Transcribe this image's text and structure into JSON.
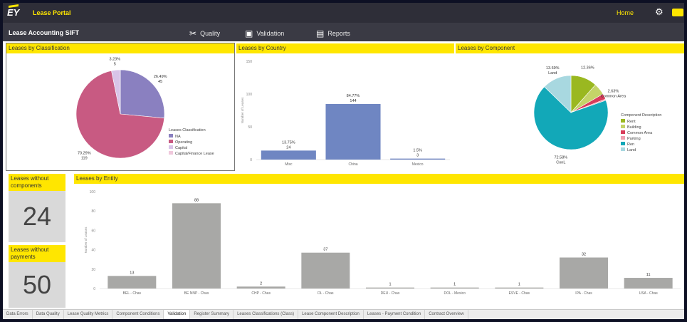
{
  "header": {
    "app_title": "Lease Portal",
    "home_label": "Home"
  },
  "subheader": {
    "report_title": "Lease Accounting SIFT",
    "nav": [
      {
        "label": "Quality",
        "icon": "tools-icon"
      },
      {
        "label": "Validation",
        "icon": "clipboard-icon"
      },
      {
        "label": "Reports",
        "icon": "document-icon"
      }
    ]
  },
  "panels": {
    "classification": "Leases by Classification",
    "country": "Leases by Country",
    "component": "Leases by Component",
    "entity": "Leases by Entity"
  },
  "kpis": {
    "components_label": "Leases without components",
    "components_value": "24",
    "payments_label": "Leases without payments",
    "payments_value": "50"
  },
  "tabs": [
    "Data Errors",
    "Data Quality",
    "Lease Quality Metrics",
    "Component Conditions",
    "Validation",
    "Register Summary",
    "Leases Classifications (Class)",
    "Lease Component Description",
    "Leases - Payment Condition",
    "Contract Overview"
  ],
  "active_tab_index": 4,
  "chart_data": [
    {
      "type": "pie",
      "title": "Leases by Classification",
      "legend_title": "Leases Classification",
      "slices": [
        {
          "name": "NA",
          "label1": "26.49%",
          "label2": "45",
          "value": 26.49,
          "color": "#8a80c0"
        },
        {
          "name": "Operating",
          "label1": "70.29%",
          "label2": "119",
          "value": 70.29,
          "color": "#c85a82"
        },
        {
          "name": "Capital",
          "label1": "3.23%",
          "label2": "5",
          "value": 3.23,
          "color": "#d8c4e8"
        },
        {
          "name": "Capital/Finance Lease",
          "label1": "",
          "label2": "",
          "value": 0,
          "color": "#f0c8dc"
        }
      ]
    },
    {
      "type": "bar",
      "title": "Leases by Country",
      "ylabel": "Number of Leases",
      "categories": [
        "Misc",
        "China",
        "Mexico"
      ],
      "values": [
        13.75,
        84.77,
        1.5
      ],
      "labels1": [
        "13.75%",
        "84.77%",
        "1.5%"
      ],
      "labels2": [
        "24",
        "144",
        "3"
      ],
      "yticks": [
        "0",
        "50",
        "100",
        "150"
      ],
      "ylim": [
        0,
        150
      ],
      "color": "#6f86c2"
    },
    {
      "type": "pie",
      "title": "Leases by Component",
      "legend_title": "Component Description",
      "slices": [
        {
          "name": "Rent",
          "label1": "12.36%",
          "label2": "",
          "value": 12.36,
          "color": "#9ab820"
        },
        {
          "name": "Building",
          "label1": "",
          "label2": "",
          "value": 5.5,
          "color": "#c4d468"
        },
        {
          "name": "Common Area",
          "label1": "2.63%",
          "label2": "Common Area",
          "value": 2.63,
          "color": "#d83c5a"
        },
        {
          "name": "Parking",
          "label1": "",
          "label2": "",
          "value": 0.6,
          "color": "#f0a0b0"
        },
        {
          "name": "Ren",
          "label1": "72.58%",
          "label2": "ConL",
          "value": 72.58,
          "color": "#12a8b8"
        },
        {
          "name": "Land",
          "label1": "13.69%",
          "label2": "Land",
          "value": 13.69,
          "color": "#a8d8e0"
        }
      ]
    },
    {
      "type": "bar",
      "title": "Leases by Entity",
      "ylabel": "Number of Leases",
      "categories": [
        "BEL - Chas",
        "BE NNP - Chas",
        "CHP - Chas",
        "DL - Chas",
        "DEU - Chas",
        "DOL - Mexico",
        "ESVE - Chas",
        "IPA - Chas",
        "USA - Chas"
      ],
      "values": [
        13,
        88,
        2,
        37,
        1,
        1,
        1,
        32,
        11
      ],
      "labels": [
        "13",
        "88",
        "2",
        "37",
        "1",
        "1",
        "1",
        "32",
        "11"
      ],
      "yticks": [
        "0",
        "20",
        "40",
        "60",
        "80",
        "100"
      ],
      "ylim": [
        0,
        100
      ],
      "color": "#a8a8a6"
    }
  ]
}
